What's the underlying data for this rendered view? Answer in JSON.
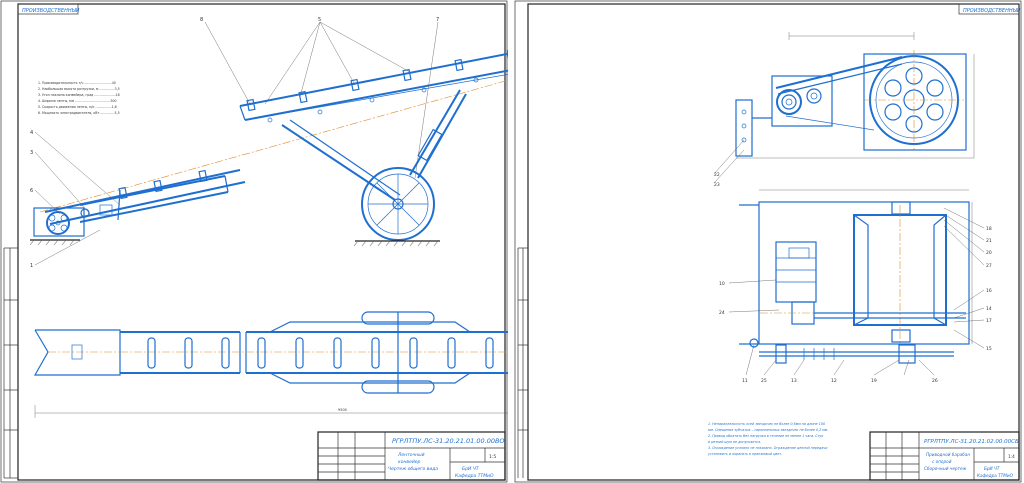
{
  "left_sheet": {
    "corner_stamp": "ПРОИЗВОДСТВЕННЫЙ",
    "designation": "РГРЛТПУ.ЛС-31.20.21.01.00.00ВО",
    "title_line1": "Ленточный",
    "title_line2": "конвейер",
    "title_line3": "Чертеж общего вида",
    "sheet_number": "1:5",
    "organization_line1": "БрИ ЧТ",
    "organization_line2": "Кафедра ТТМиО",
    "overall_length": "9500",
    "notes": [
      "1. Производительность т/ч ...........................40",
      "2. Наибольшая высота разгрузки, м ...............3,5",
      "3. Угол наклона конвейера, град .....................18",
      "4. Ширина ленты, мм ...................................500",
      "5. Скорость движения ленты, м/с ................1,6",
      "6. Мощность электродвигателя, кВт ..............5,5"
    ],
    "callouts": [
      "1",
      "2",
      "3",
      "4",
      "5",
      "6",
      "7",
      "8"
    ]
  },
  "right_sheet": {
    "corner_stamp": "ПРОИЗВОДСТВЕННЫЙ",
    "designation": "РГРЛТПУ.ЛС-31.20.21.02.00.00СБ",
    "title_line1": "Приводной барабан",
    "title_line2": "с опорой",
    "title_line3": "Сборочный чертеж",
    "sheet_number": "1:4",
    "organization_line1": "БрИ ЧТ",
    "organization_line2": "Кафедра ТТМиО",
    "notes": [
      "1. Непараллельность осей звездочек не более 0,6мм на длине 100",
      "мм. Смещение зубчатых – параллельных звездочек не более 0,2 мм.",
      "2. Привод обкатать без нагрузки в течение не менее 1 часа. Стук",
      "и резкий шум не допускается.",
      "3. Ограждение условно не показано. Ограждение цепной передачи",
      "установить и окрасить в oранжевый цвет."
    ],
    "callouts": [
      "10",
      "11",
      "12",
      "13",
      "14",
      "15",
      "16",
      "17",
      "18",
      "19",
      "20",
      "21",
      "22",
      "23",
      "24",
      "25",
      "26",
      "27"
    ]
  }
}
